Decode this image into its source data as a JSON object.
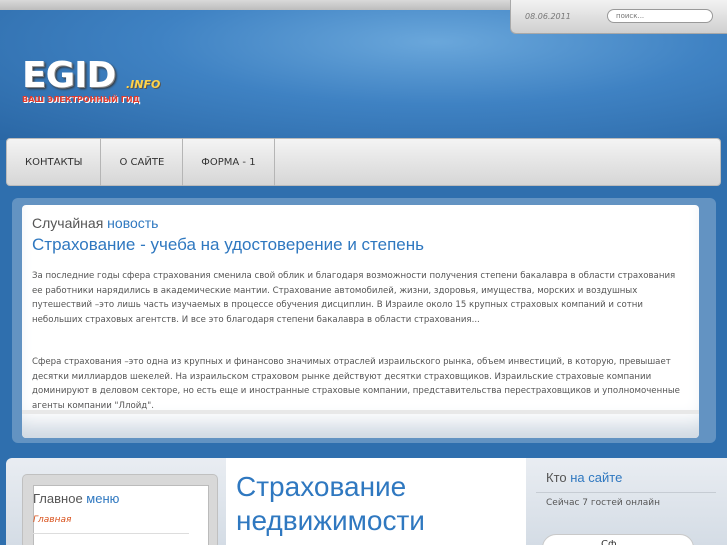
{
  "top": {
    "date": "08.06.2011",
    "search_placeholder": "поиск..."
  },
  "logo": {
    "main": "EGID",
    "suffix": ".INFO",
    "tagline": "ВАШ ЭЛЕКТРОННЫЙ ГИД"
  },
  "nav": {
    "items": [
      {
        "label": "КОНТАКТЫ"
      },
      {
        "label": "О САЙТЕ"
      },
      {
        "label": "ФОРМА - 1"
      }
    ]
  },
  "random_news": {
    "heading_plain": "Случайная",
    "heading_accent": "новость",
    "title": "Страхование - учеба на удостоверение и степень",
    "paragraph1": "За последние годы сфера страхования сменила свой облик и благодаря возможности получения степени бакалавра в области страхования ее работники нарядились в академические мантии. Страхование автомобилей, жизни, здоровья, имущества, морских и воздушных путешествий –это лишь часть изучаемых в процессе обучения дисциплин. В Израиле около 15 крупных страховых компаний и сотни небольших страховых агентств. И все это благодаря степени бакалавра в области страхования...",
    "paragraph2": "Сфера страхования –это одна из крупных и финансово значимых отраслей израильского рынка, объем инвестиций, в которую, превышает десятки миллиардов шекелей. На израильском страховом рынке действуют десятки страховщиков. Израильские страховые компании доминируют в деловом секторе, но есть еще и иностранные страховые компании, представительства перестраховщиков и уполномоченные агенты компании \"Ллойд\"."
  },
  "main_menu": {
    "title_plain": "Главное",
    "title_accent": "меню",
    "items": [
      {
        "label": "Главная"
      }
    ]
  },
  "article": {
    "title": "Страхование недвижимости"
  },
  "online": {
    "title_plain": "Кто",
    "title_accent": "на сайте",
    "status": "Сейчас 7 гостей онлайн"
  },
  "module": {
    "label": "Сф"
  },
  "colors": {
    "accent": "#2f78c0",
    "menu_link": "#d9531e",
    "header_blue": "#3f82c3"
  }
}
